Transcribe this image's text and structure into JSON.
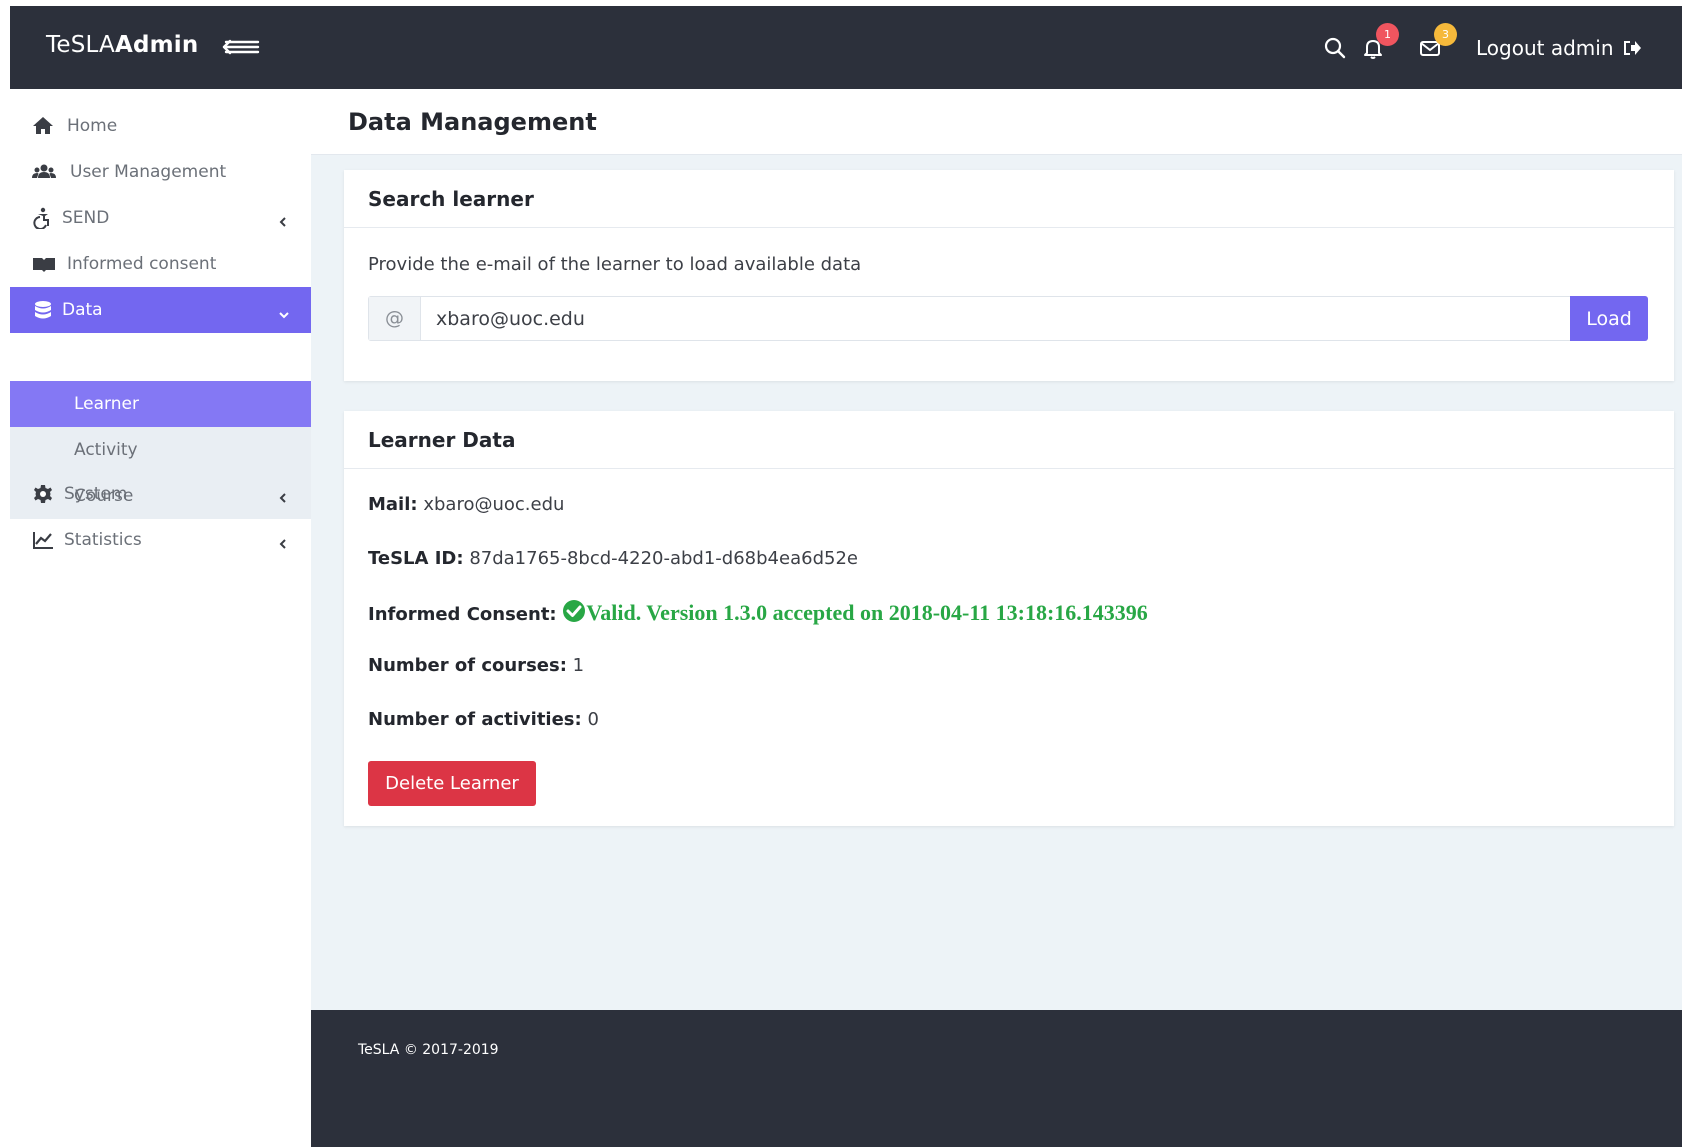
{
  "brand": {
    "prefix": "TeSLA",
    "bold": "Admin"
  },
  "topbar": {
    "notifications_count": "1",
    "messages_count": "3",
    "logout_label": "Logout admin"
  },
  "sidebar": {
    "items": [
      {
        "label": "Home",
        "icon": "home-icon"
      },
      {
        "label": "User Management",
        "icon": "users-icon"
      },
      {
        "label": "SEND",
        "icon": "accessibility-icon"
      },
      {
        "label": "Informed consent",
        "icon": "book-icon"
      },
      {
        "label": "Data",
        "icon": "database-icon"
      },
      {
        "label": "System",
        "icon": "gear-icon"
      },
      {
        "label": "Statistics",
        "icon": "chart-line-icon"
      }
    ],
    "data_submenu": [
      "Learner",
      "Activity",
      "Course"
    ]
  },
  "page": {
    "title": "Data Management"
  },
  "search": {
    "title": "Search learner",
    "help": "Provide the e-mail of the learner to load available data",
    "addon": "@",
    "value": "xbaro@uoc.edu",
    "load_label": "Load"
  },
  "learner": {
    "title": "Learner Data",
    "mail_label": "Mail:",
    "mail": "xbaro@uoc.edu",
    "id_label": "TeSLA ID:",
    "id": "87da1765-8bcd-4220-abd1-d68b4ea6d52e",
    "consent_label": "Informed Consent:",
    "consent_status": "Valid. Version 1.3.0 accepted on 2018-04-11 13:18:16.143396",
    "courses_label": "Number of courses:",
    "courses": "1",
    "activities_label": "Number of activities:",
    "activities": "0",
    "delete_label": "Delete Learner"
  },
  "footer": {
    "text": "TeSLA © 2017-2019"
  },
  "colors": {
    "accent": "#7367f0",
    "topbar": "#2c303b",
    "danger": "#dc3545",
    "success": "#28a745"
  }
}
